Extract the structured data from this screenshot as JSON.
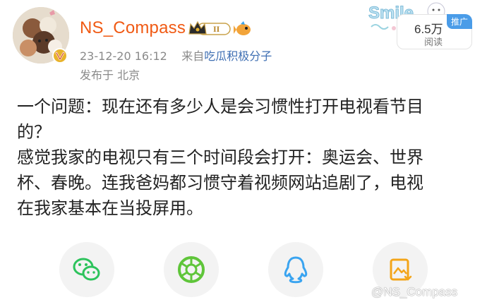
{
  "user": {
    "name": "NS_Compass",
    "level_badge": "II",
    "verified_icon": "verified-v-icon",
    "crown_icon": "crown-level-icon",
    "fish_icon": "fish-emoji-icon"
  },
  "meta": {
    "time": "23-12-20 16:12",
    "from_prefix": "来自",
    "source": "吃瓜积极分子",
    "location": "发布于 北京"
  },
  "promo": {
    "sticker_text": "Smile",
    "tag": "推广",
    "views": "6.5万",
    "views_label": "阅读"
  },
  "post": {
    "lines": [
      "一个问题：现在还有多少人是会习惯性打开电视看节目",
      "的？",
      "感觉我家的电视只有三个时间段会打开：奥运会、世界",
      "杯、春晚。连我爸妈都习惯守着视频网站追剧了，电视",
      "在我家基本在当投屏用。"
    ]
  },
  "share": {
    "buttons": [
      "wechat-icon",
      "moments-icon",
      "qq-icon",
      "save-image-icon"
    ]
  },
  "watermark": "@NS_Compass",
  "colors": {
    "username": "#f05a14",
    "link": "#3f6fb3",
    "meta": "#8a8a8a",
    "wechat": "#2dc35c",
    "moments": "#5fc53a",
    "qq": "#3aa4f0",
    "save": "#f3a519",
    "promo_tag": "#4a9ce8"
  }
}
